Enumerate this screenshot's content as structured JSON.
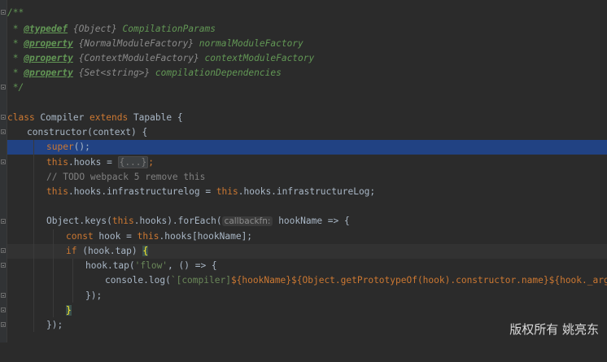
{
  "editor": {
    "colors": {
      "background": "#2b2b2b",
      "keyword": "#cc7832",
      "doc_comment": "#629755",
      "string": "#6a8759",
      "comment": "#808080",
      "selection": "#214283",
      "text": "#a9b7c6"
    },
    "doc": {
      "open": "/**",
      "typedef_tag": "@typedef",
      "typedef_type": "{Object}",
      "typedef_name": "CompilationParams",
      "p1_tag": "@property",
      "p1_type": "{NormalModuleFactory}",
      "p1_name": "normalModuleFactory",
      "p2_tag": "@property",
      "p2_type": "{ContextModuleFactory}",
      "p2_name": "contextModuleFactory",
      "p3_tag": "@property",
      "p3_type": "{Set<string>}",
      "p3_name": "compilationDependencies",
      "star": " * ",
      "close": " */"
    },
    "code": {
      "class_kw": "class",
      "class_name": " Compiler ",
      "extends_kw": "extends",
      "parent": " Tapable {",
      "ctor": "constructor(context) {",
      "super_kw": "super",
      "super_rest": "();",
      "this_kw": "this",
      "hooks_assign": ".hooks = ",
      "folded": "{...}",
      "semicolon": ";",
      "todo_comment": "// TODO webpack 5 remove this",
      "infra_mid": ".hooks.infrastructurelog = ",
      "infra_end": ".hooks.infrastructureLog;",
      "keys_start": "Object.keys(",
      "keys_mid": ".hooks).forEach(",
      "param_hint": "callbackfn:",
      "keys_end": " hookName => {",
      "const_kw": "const",
      "hook_decl": " hook = ",
      "hook_rhs": ".hooks[hookName];",
      "if_kw": "if",
      "if_cond": " (hook.tap) ",
      "open_brace": "{",
      "tap_call": "hook.tap(",
      "flow_str": "'flow'",
      "tap_rest": ", () => {",
      "console_log": "console.log(",
      "tpl_tick": "`",
      "tpl_compiler": "[compiler]",
      "tpl_e1": "${hookName}",
      "tpl_e2": "${Object.getPrototypeOf(hook).constructor.name}",
      "tpl_e3": "${hook._args}",
      "log_end": ");",
      "close_paren": "});",
      "close_brace": "}",
      "close_foreach": "});"
    }
  },
  "watermark": "版权所有 姚亮东"
}
